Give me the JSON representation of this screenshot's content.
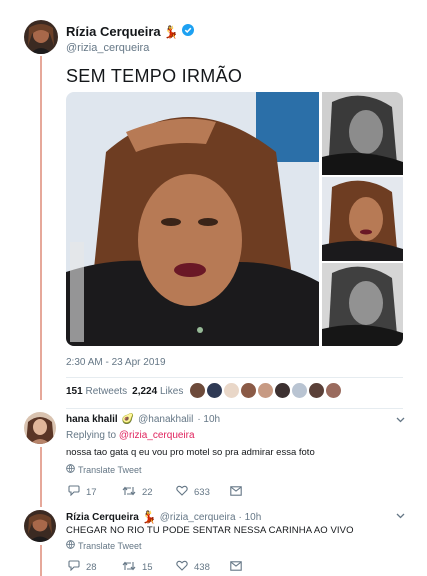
{
  "author": {
    "name": "Rízia Cerqueira",
    "emoji": "💃",
    "handle": "@rizia_cerqueira"
  },
  "tweet": {
    "text": "SEM TEMPO IRMÃO",
    "timestamp": "2:30 AM - 23 Apr 2019"
  },
  "stats": {
    "retweets_count": "151",
    "retweets_label": "Retweets",
    "likes_count": "2,224",
    "likes_label": "Likes"
  },
  "replies": [
    {
      "name": "hana khalil",
      "emoji": "🥑",
      "handle": "@hanakhalil",
      "time": "· 10h",
      "replying_prefix": "Replying to",
      "replying_to": "@rizia_cerqueira",
      "text": "nossa tao gata q eu vou pro motel so pra admirar essa foto",
      "translate": "Translate Tweet",
      "counts": {
        "replies": "17",
        "retweets": "22",
        "likes": "633"
      }
    },
    {
      "name": "Rízia Cerqueira",
      "emoji": "💃",
      "handle": "@rizia_cerqueira",
      "time": "· 10h",
      "text": "CHEGAR NO RIO TU PODE SENTAR NESSA CARINHA AO VIVO",
      "translate": "Translate Tweet",
      "counts": {
        "replies": "28",
        "retweets": "15",
        "likes": "438"
      }
    }
  ],
  "colors": {
    "verified": "#1da1f2",
    "mention": "#e0245e",
    "secondary_text": "#657786",
    "thread_line": "#e6a89a"
  }
}
